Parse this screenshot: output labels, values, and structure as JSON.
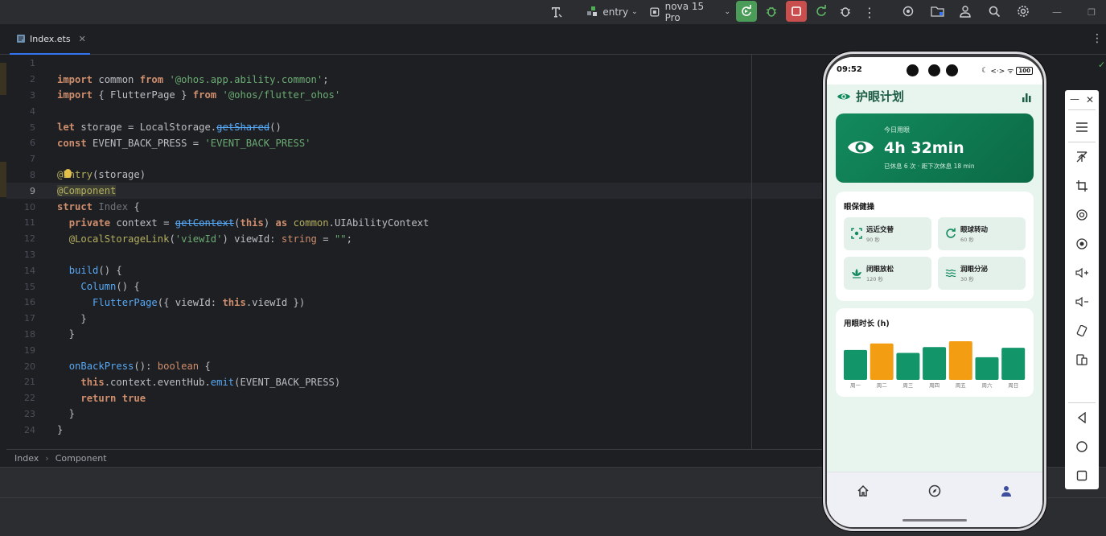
{
  "toolbar": {
    "run_config": "entry",
    "device": "nova 15 Pro"
  },
  "editor": {
    "tab_label": "Index.ets",
    "line_numbers": [
      "1",
      "2",
      "3",
      "4",
      "5",
      "6",
      "7",
      "8",
      "9",
      "10",
      "11",
      "12",
      "13",
      "14",
      "15",
      "16",
      "17",
      "18",
      "19",
      "20",
      "21",
      "22",
      "23",
      "24"
    ],
    "current_line": 9
  },
  "breadcrumb": {
    "item1": "Index",
    "item2": "Component"
  },
  "phone": {
    "status_time": "09:52",
    "status_icons": "<·> ᯤ",
    "battery": "100",
    "app_title": "护眼计划",
    "hero": {
      "label": "今日用眼",
      "value": "4h 32min",
      "sub": "已休息 6 次 · 距下次休息 18 min"
    },
    "exercise_title": "眼保健操",
    "exercises": [
      {
        "name": "远近交替",
        "duration": "90 秒",
        "icon": "focus-icon"
      },
      {
        "name": "眼球转动",
        "duration": "60 秒",
        "icon": "rotate-icon"
      },
      {
        "name": "闭眼放松",
        "duration": "120 秒",
        "icon": "lotus-icon"
      },
      {
        "name": "润眼分泌",
        "duration": "30 秒",
        "icon": "wave-icon"
      }
    ],
    "chart_title": "用眼时长 (h)",
    "nav": [
      "home-icon",
      "compass-icon",
      "person-icon"
    ]
  },
  "colors": {
    "brand_green": "#138a5e",
    "bar_green": "#13956a",
    "bar_orange": "#f29d12"
  },
  "chart_data": {
    "type": "bar",
    "title": "用眼时长 (h)",
    "categories": [
      "周一",
      "周二",
      "周三",
      "周四",
      "周五",
      "周六",
      "周日"
    ],
    "values": [
      4.1,
      5.0,
      3.7,
      4.5,
      5.3,
      3.1,
      4.4
    ],
    "highlight": [
      "周二",
      "周五"
    ],
    "highlight_color": "#f29d12",
    "bar_color": "#13956a"
  }
}
